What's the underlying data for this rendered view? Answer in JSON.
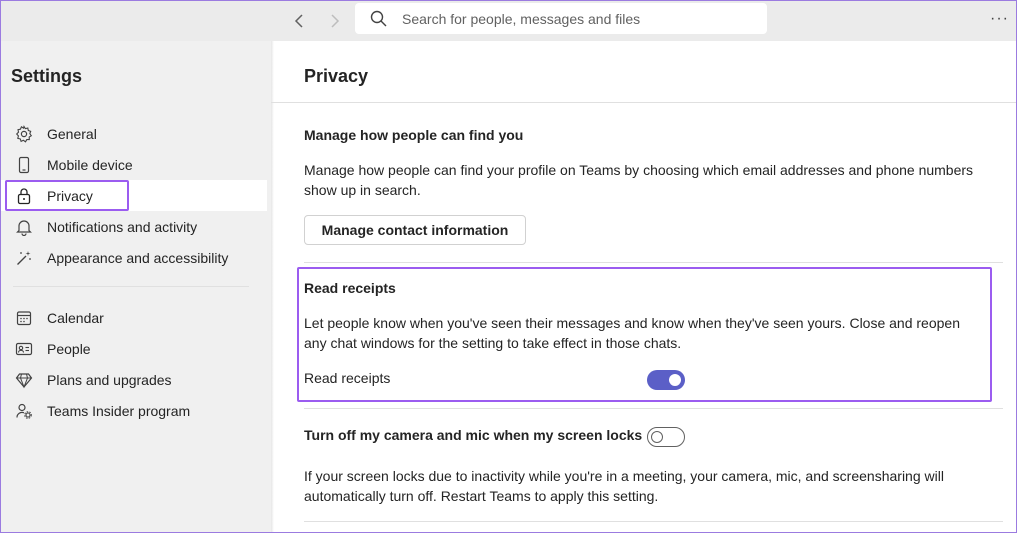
{
  "topbar": {
    "back_icon": "chevron-left-icon",
    "forward_icon": "chevron-right-icon",
    "search": {
      "placeholder": "Search for people, messages and files",
      "icon": "search-icon"
    },
    "more_label": "···"
  },
  "sidebar": {
    "title": "Settings",
    "items": [
      {
        "label": "General",
        "icon": "gear-icon"
      },
      {
        "label": "Mobile device",
        "icon": "phone-icon"
      },
      {
        "label": "Privacy",
        "icon": "lock-icon",
        "active": true
      },
      {
        "label": "Notifications and activity",
        "icon": "bell-icon"
      },
      {
        "label": "Appearance and accessibility",
        "icon": "wand-icon"
      },
      {
        "label": "Calendar",
        "icon": "calendar-icon"
      },
      {
        "label": "People",
        "icon": "contact-card-icon"
      },
      {
        "label": "Plans and upgrades",
        "icon": "diamond-icon"
      },
      {
        "label": "Teams Insider program",
        "icon": "person-gear-icon"
      }
    ]
  },
  "main": {
    "title": "Privacy",
    "find_you": {
      "heading": "Manage how people can find you",
      "description": "Manage how people can find your profile on Teams by choosing which email addresses and phone numbers show up in search.",
      "button_label": "Manage contact information"
    },
    "read_receipts": {
      "heading": "Read receipts",
      "description": "Let people know when you've seen their messages and know when they've seen yours. Close and reopen any chat windows for the setting to take effect in those chats.",
      "toggle_label": "Read receipts",
      "toggle_on": true
    },
    "camera_mic": {
      "heading": "Turn off my camera and mic when my screen locks",
      "toggle_on": false,
      "description": "If your screen locks due to inactivity while you're in a meeting, your camera, mic, and screensharing will automatically turn off. Restart Teams to apply this setting."
    }
  },
  "colors": {
    "accent": "#5b5fc7",
    "highlight": "#9b5cf0",
    "sidebar_bg": "#f0f0f0",
    "topbar_bg": "#ebebeb"
  }
}
